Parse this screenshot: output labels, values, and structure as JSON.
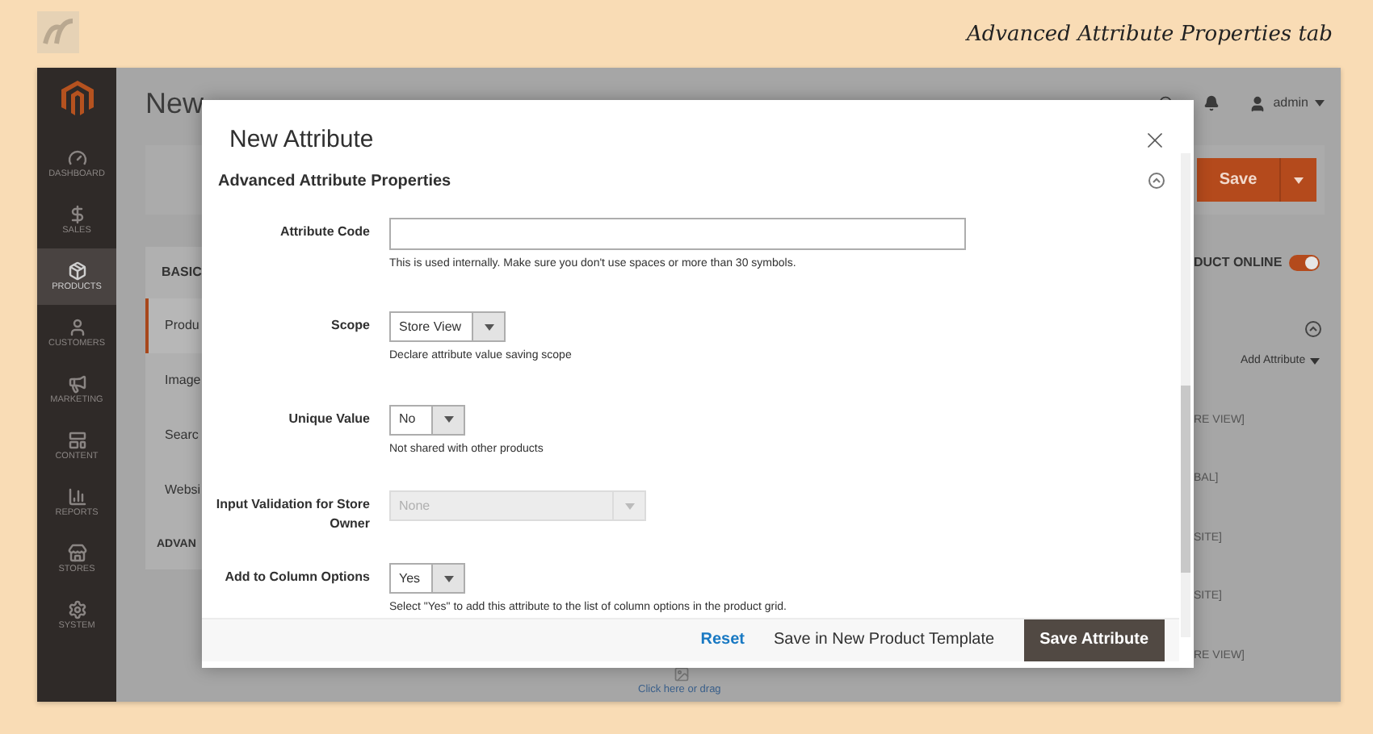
{
  "header": {
    "caption": "Advanced Attribute Properties tab"
  },
  "sidebar": {
    "items": [
      {
        "kind": "dashboard",
        "label": "DASHBOARD",
        "selected": false
      },
      {
        "kind": "sales",
        "label": "SALES",
        "selected": false
      },
      {
        "kind": "products",
        "label": "PRODUCTS",
        "selected": true
      },
      {
        "kind": "customers",
        "label": "CUSTOMERS",
        "selected": false
      },
      {
        "kind": "marketing",
        "label": "MARKETING",
        "selected": false
      },
      {
        "kind": "content",
        "label": "CONTENT",
        "selected": false
      },
      {
        "kind": "reports",
        "label": "REPORTS",
        "selected": false
      },
      {
        "kind": "stores",
        "label": "STORES",
        "selected": false
      },
      {
        "kind": "system",
        "label": "SYSTEM",
        "selected": false
      }
    ]
  },
  "page": {
    "title": "New",
    "user": "admin",
    "save_button": "Save",
    "left_nav": {
      "heading": "BASIC",
      "items": [
        {
          "label": "Produ",
          "selected": true
        },
        {
          "label": "Image",
          "selected": false
        },
        {
          "label": "Searc",
          "selected": false
        },
        {
          "label": "Websi",
          "selected": false
        }
      ],
      "footer": "ADVAN"
    },
    "right_panel": {
      "online_label": "DUCT ONLINE",
      "online": true,
      "add_attribute": "Add Attribute",
      "scopes": [
        "RE VIEW]",
        "BAL]",
        "SITE]",
        "SITE]",
        "RE VIEW]"
      ]
    },
    "upload_link": "Click here or drag"
  },
  "modal": {
    "title": "New Attribute",
    "section": "Advanced Attribute Properties",
    "fields": [
      {
        "kind": "text",
        "label": "Attribute Code",
        "note": "This is used internally. Make sure you don't use spaces or more than 30 symbols."
      },
      {
        "kind": "select",
        "label": "Scope",
        "value": "Store View",
        "disabled": false,
        "note": "Declare attribute value saving scope"
      },
      {
        "kind": "select",
        "label": "Unique Value",
        "value": "No",
        "disabled": false,
        "note": "Not shared with other products"
      },
      {
        "kind": "select",
        "label": "Input Validation for Store Owner",
        "value": "None",
        "disabled": true
      },
      {
        "kind": "select",
        "label": "Add to Column Options",
        "value": "Yes",
        "disabled": false,
        "note": "Select \"Yes\" to add this attribute to the list of column options in the product grid."
      }
    ],
    "buttons": [
      {
        "kind": "link",
        "label": "Reset"
      },
      {
        "kind": "secondary",
        "label": "Save in New Product Template"
      },
      {
        "kind": "primary",
        "label": "Save Attribute"
      }
    ]
  }
}
